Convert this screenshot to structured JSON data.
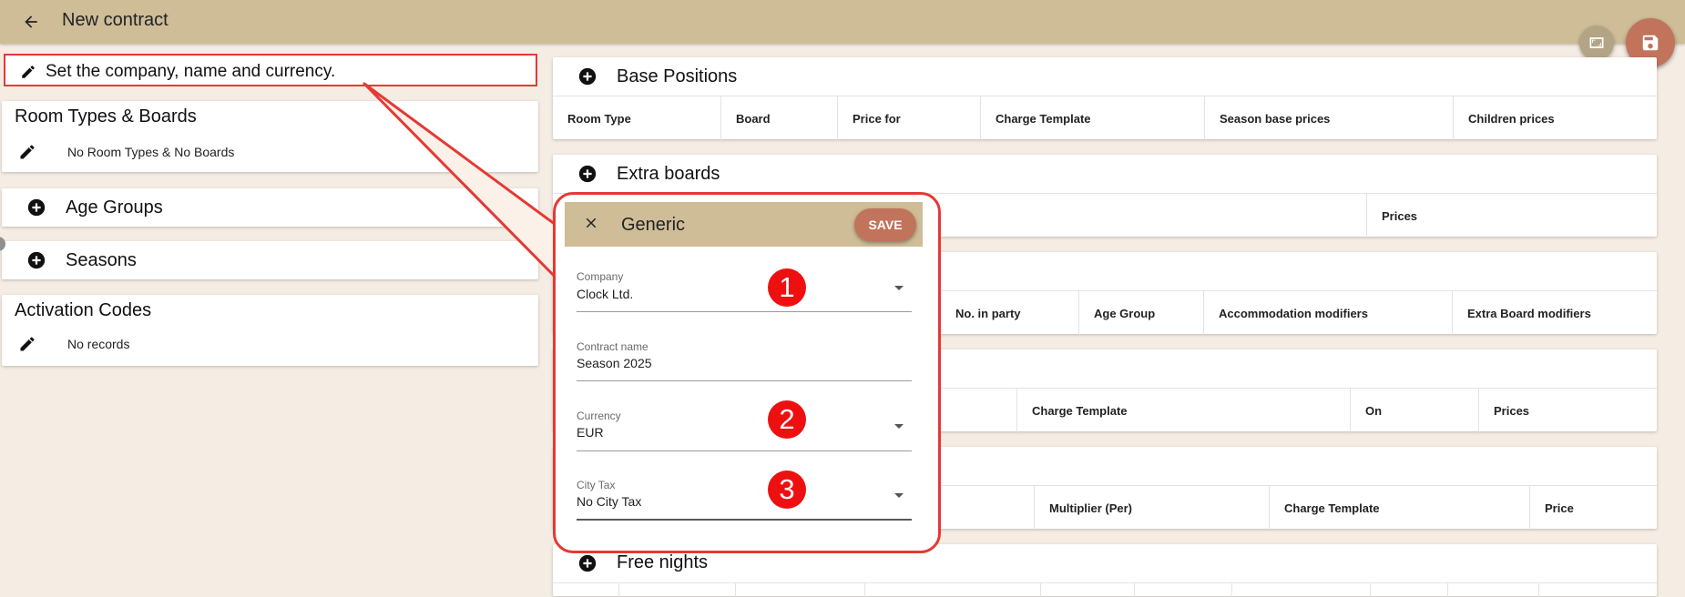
{
  "app_bar": {
    "title": "New contract",
    "back_icon": "arrow-back-icon",
    "color": "#cfbd98"
  },
  "fabs": {
    "fullscreen_icon": "fullscreen-icon",
    "save_icon": "floppy-disk-icon",
    "save_color": "#c2735c"
  },
  "hint": {
    "text": "Set the company, name and currency.",
    "icon": "pencil-icon",
    "border_color": "#e53935"
  },
  "left_panel": {
    "room_types": {
      "title": "Room Types & Boards",
      "sub": "No Room Types & No Boards"
    },
    "age_groups": {
      "title": "Age Groups"
    },
    "seasons": {
      "title": "Seasons"
    },
    "activation_codes": {
      "title": "Activation Codes",
      "sub": "No records"
    }
  },
  "right_panel": {
    "base_positions": {
      "title": "Base Positions",
      "columns": [
        "Room Type",
        "Board",
        "Price for",
        "Charge Template",
        "Season base prices",
        "Children prices"
      ]
    },
    "extra_boards": {
      "title": "Extra boards",
      "columns": [
        "Prices"
      ]
    },
    "section3": {
      "columns": [
        "No. in party",
        "Age Group",
        "Accommodation modifiers",
        "Extra Board modifiers"
      ]
    },
    "section4": {
      "columns": [
        "Charge Template",
        "On",
        "Prices"
      ]
    },
    "section5": {
      "columns": [
        "Multiplier (Per)",
        "Charge Template",
        "Price"
      ]
    },
    "free_nights": {
      "title": "Free nights"
    }
  },
  "dialog": {
    "title": "Generic",
    "save_label": "SAVE",
    "fields": {
      "company": {
        "label": "Company",
        "value": "Clock Ltd."
      },
      "contract_name": {
        "label": "Contract name",
        "value": "Season 2025"
      },
      "currency": {
        "label": "Currency",
        "value": "EUR"
      },
      "city_tax": {
        "label": "City Tax",
        "value": "No City Tax"
      }
    },
    "markers": [
      "1",
      "2",
      "3"
    ],
    "marker_color": "#ee1010"
  }
}
